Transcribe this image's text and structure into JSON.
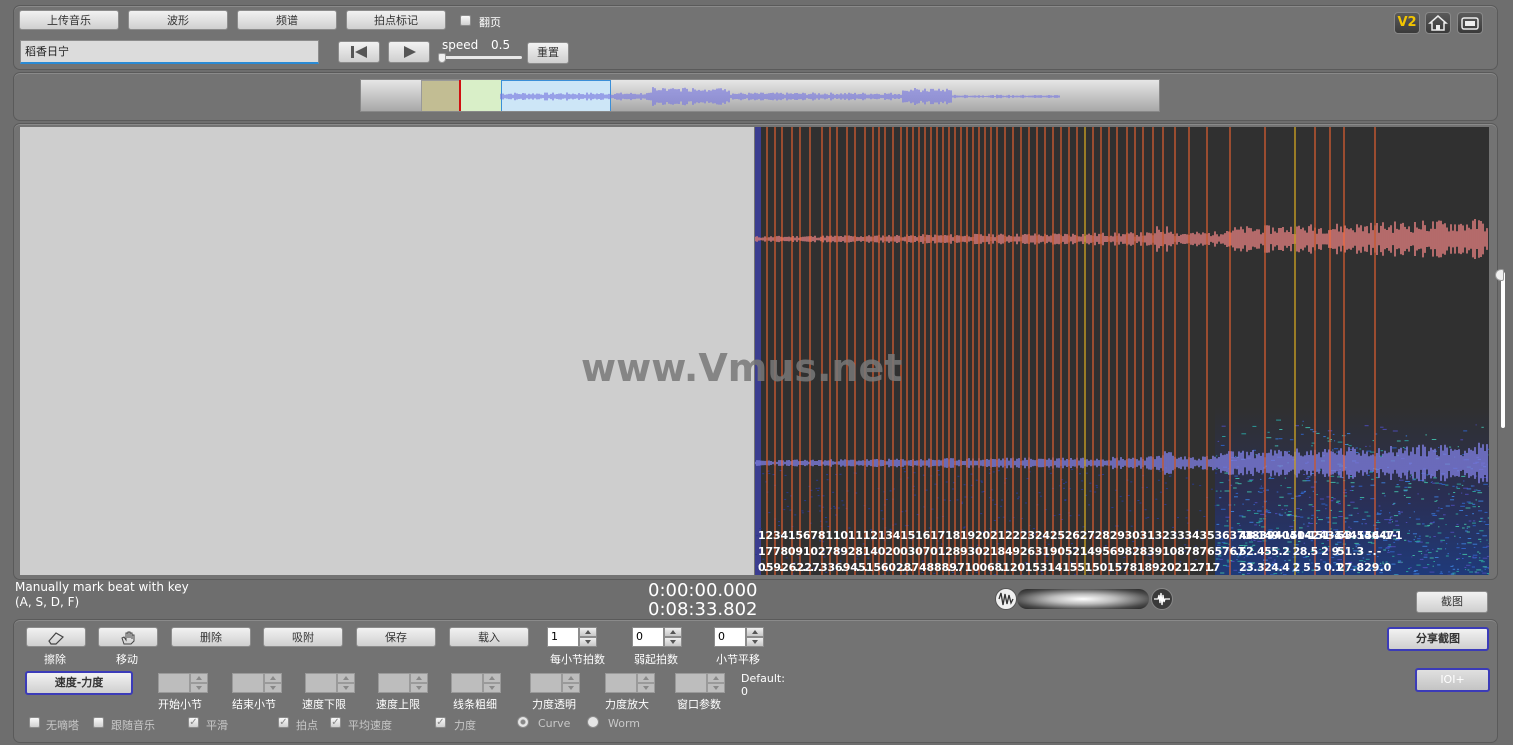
{
  "toolbar": {
    "upload_label": "上传音乐",
    "waveform_label": "波形",
    "spectrum_label": "频谱",
    "beat_mark_label": "拍点标记",
    "flip_label": "翻页",
    "title_value": "稻香日宁",
    "speed_label": "speed",
    "speed_value": "0.5",
    "reset_label": "重置",
    "v2_badge": "V2"
  },
  "overview": {
    "playhead_color": "#d01010",
    "wave_color": "#7a7adf",
    "selection_color": "#cde6f7"
  },
  "watermark": "www.Vmus.net",
  "beat_labels": {
    "row1": "1 2 3 4 1 5 6 7 8 1 1 0 1 1 1 2 1 3 4 1 5 1 6 1 7 1 8 1 9 2 0 2 1 2 2 2 3 2 4 2 5 2 6 2 7 2 8 2 9 3 0 3 1 3 2 3 3 3 4 3 5 3 6 3 7 3 8 3 9 4 0 4 1 4 2 4 3 4 4 4 5 4 6 4 7-1",
    "row1_tail_a": "48-149-150-151-1",
    "row1_tail_b": "53-154-1",
    "row2": "1 7 7 8 0 9 1 0 2 7 8 9 2 8 1 4 0 2 0 0 3 0 7 0 1 2 8 9 3 0 2 1 8 4 9 2 6 3 1 9 0 5 2 1 4 9 5 6 9 8 2 8 3 9 1 0 8 7 8 7 6 5 7 6.7",
    "row2_tail_a": "52.455.2 28.5 2 9",
    "row2_tail_b": "51.3 -.-",
    "row3": "0.5 9.2 6.2.2.7.3 3 6.9 4.5.1 5 6 0 2.8.7 4 8 8 8.9.7 1 0 0 6 8.1 2 0 1 5 3 1 4 1 5 5 1 5 0 1 5 7 8 1 8 9 2 0 2 1 2.7 1.7",
    "row3_tail_a": "23.324.4 2 5 5 0.1",
    "row3_tail_b": "27.829.0"
  },
  "hint": {
    "line1": "Manually mark beat with key",
    "line2": "(A, S, D, F)"
  },
  "time": {
    "current": "0:00:00.000",
    "total": "0:08:33.802"
  },
  "screenshot_label": "截图",
  "edit": {
    "erase_label": "擦除",
    "move_label": "移动",
    "delete_label": "删除",
    "snap_label": "吸附",
    "save_label": "保存",
    "load_label": "载入",
    "beats_per_bar_value": "1",
    "beats_per_bar_label": "每小节拍数",
    "pickup_value": "0",
    "pickup_label": "弱起拍数",
    "bar_offset_value": "0",
    "bar_offset_label": "小节平移",
    "share_label": "分享截图",
    "ioi_label": "IOI+",
    "tempo_dynamics_label": "速度-力度",
    "start_bar_label": "开始小节",
    "end_bar_label": "结束小节",
    "tempo_min_label": "速度下限",
    "tempo_max_label": "速度上限",
    "line_width_label": "线条粗细",
    "dyn_alpha_label": "力度透明",
    "dyn_scale_label": "力度放大",
    "window_label": "窗口参数",
    "default_label": "Default:",
    "default_value": "0",
    "no_smooth_label": "无嘀嗒",
    "follow_label": "跟随音乐",
    "smooth_label": "平滑",
    "beat_label": "拍点",
    "avg_tempo_label": "平均速度",
    "dynamics_label": "力度",
    "curve_label": "Curve",
    "worm_label": "Worm"
  }
}
